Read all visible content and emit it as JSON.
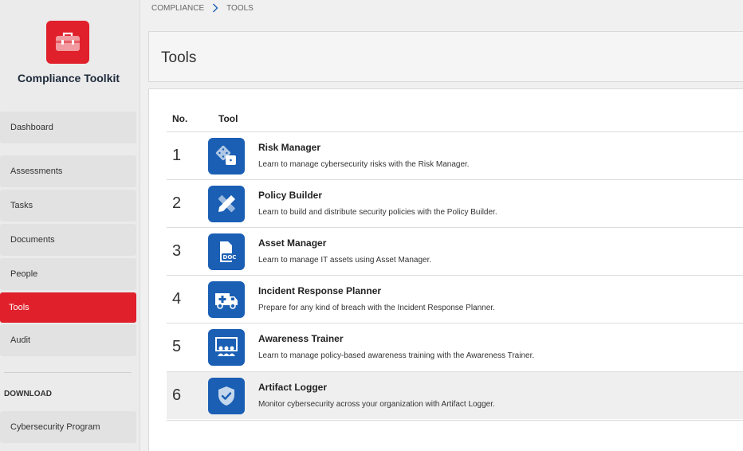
{
  "app": {
    "title": "Compliance Toolkit",
    "brand_color": "#e0202b",
    "logo_icon": "toolbox-icon"
  },
  "sidebar": {
    "items": [
      {
        "label": "Dashboard"
      },
      {
        "label": "Assessments"
      },
      {
        "label": "Tasks"
      },
      {
        "label": "Documents"
      },
      {
        "label": "People"
      },
      {
        "label": "Tools",
        "active": true
      },
      {
        "label": "Audit"
      }
    ],
    "download_label": "DOWNLOAD",
    "download_items": [
      {
        "label": "Cybersecurity Program"
      }
    ]
  },
  "breadcrumb": {
    "items": [
      "COMPLIANCE",
      "TOOLS"
    ],
    "separator_icon": "chevron-right-icon"
  },
  "page": {
    "title": "Tools"
  },
  "table": {
    "headers": {
      "no": "No.",
      "tool": "Tool"
    },
    "icon_color": "#1a5fb4",
    "rows": [
      {
        "no": "1",
        "name": "Risk Manager",
        "desc": "Learn to manage cybersecurity risks with the Risk Manager.",
        "icon": "dice-icon"
      },
      {
        "no": "2",
        "name": "Policy Builder",
        "desc": "Learn to build and distribute security policies with the Policy Builder.",
        "icon": "pencil-ruler-icon"
      },
      {
        "no": "3",
        "name": "Asset Manager",
        "desc": "Learn to manage IT assets using Asset Manager.",
        "icon": "document-icon"
      },
      {
        "no": "4",
        "name": "Incident Response Planner",
        "desc": "Prepare for any kind of breach with the Incident Response Planner.",
        "icon": "ambulance-icon"
      },
      {
        "no": "5",
        "name": "Awareness Trainer",
        "desc": "Learn to manage policy-based awareness training with the Awareness Trainer.",
        "icon": "classroom-icon"
      },
      {
        "no": "6",
        "name": "Artifact Logger",
        "desc": "Monitor cybersecurity across your organization with Artifact Logger.",
        "icon": "shield-check-icon",
        "highlighted": true
      }
    ]
  }
}
